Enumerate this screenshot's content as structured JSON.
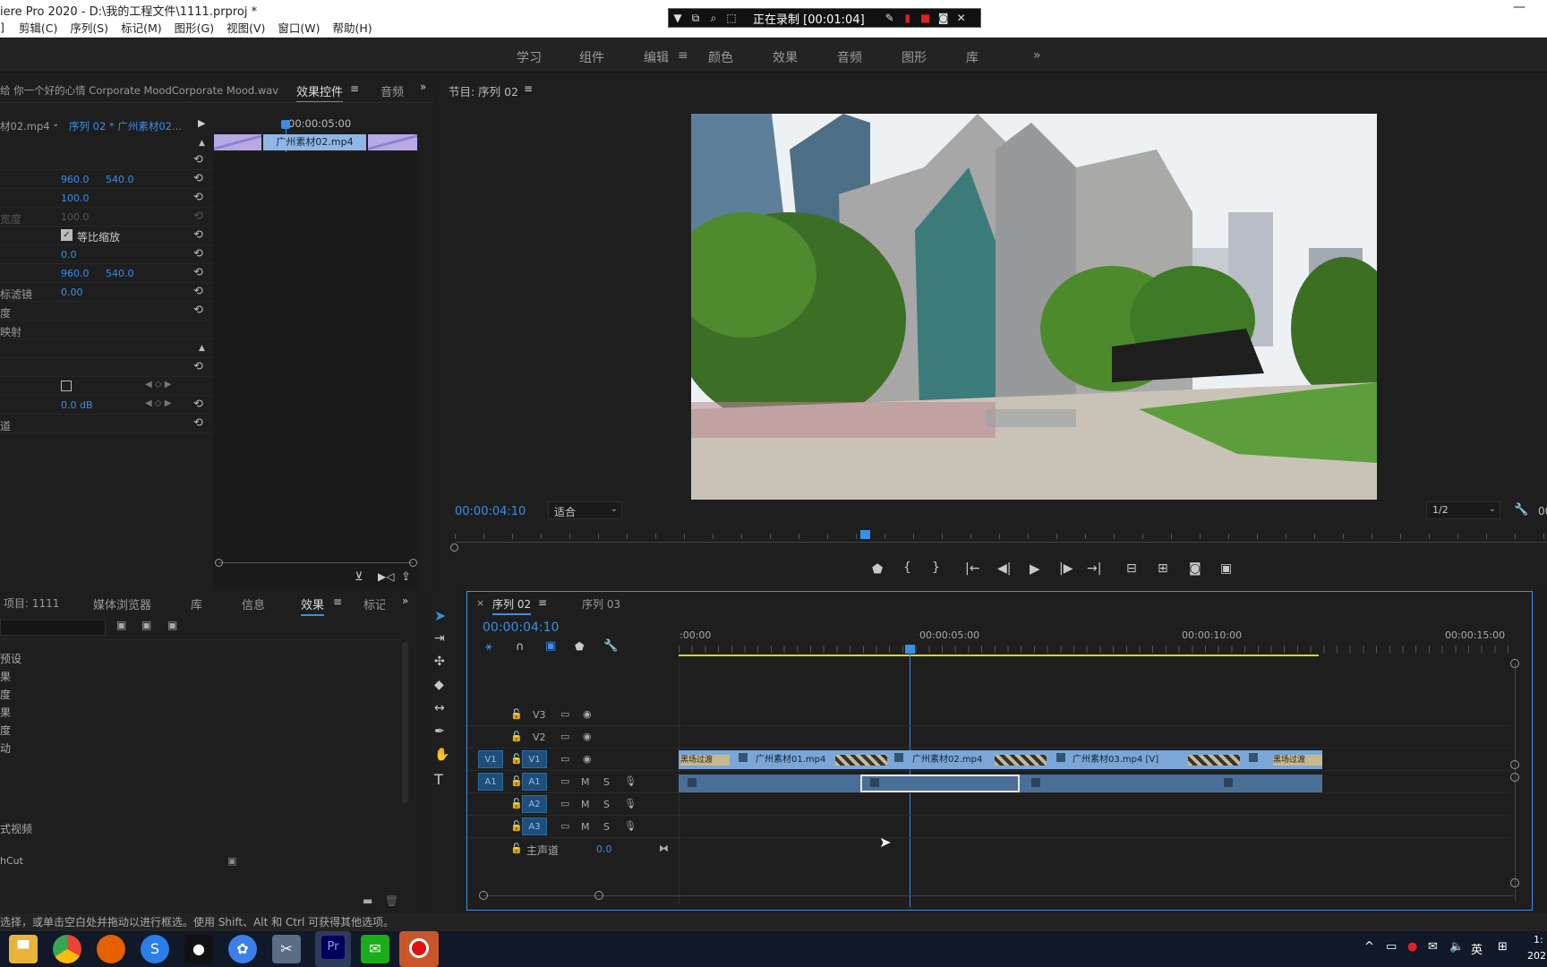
{
  "window": {
    "title": "iere Pro 2020 - D:\\我的工程文件\\1111.prproj *"
  },
  "menu": [
    "剪辑(C)",
    "序列(S)",
    "标记(M)",
    "图形(G)",
    "视图(V)",
    "窗口(W)",
    "帮助(H)"
  ],
  "recorder": {
    "status": "正在录制 [00:01:04]"
  },
  "workspaces": [
    {
      "label": "学习",
      "active": false
    },
    {
      "label": "组件",
      "active": false
    },
    {
      "label": "编辑",
      "active": true
    },
    {
      "label": "颜色",
      "active": false
    },
    {
      "label": "效果",
      "active": false
    },
    {
      "label": "音频",
      "active": false
    },
    {
      "label": "图形",
      "active": false
    },
    {
      "label": "库",
      "active": false
    }
  ],
  "source_panel": {
    "audio_title": "给 你一个好的心情 Corporate MoodCorporate Mood.wav",
    "tab_effect_controls": "效果控件",
    "tab_audio": "音频",
    "source_clip": "材02.mp4",
    "sequence_clip": "序列 02 * 广州素材02...",
    "timecode": "00:00:05:00",
    "clip_name": "广州素材02.mp4",
    "rows": [
      {
        "label": "",
        "v1": "",
        "v2": ""
      },
      {
        "label": "",
        "v1": "960.0",
        "v2": "540.0"
      },
      {
        "label": "",
        "v1": "100.0",
        "v2": ""
      },
      {
        "label": "宽度",
        "v1": "100.0",
        "v2": "",
        "dim": true
      },
      {
        "label": "",
        "v1": "等比缩放",
        "v2": "",
        "check": true
      },
      {
        "label": "",
        "v1": "0.0",
        "v2": ""
      },
      {
        "label": "",
        "v1": "960.0",
        "v2": "540.0"
      },
      {
        "label": "标滤镜",
        "v1": "0.00",
        "v2": ""
      },
      {
        "label": "度",
        "v1": "",
        "v2": ""
      },
      {
        "label": "映射",
        "v1": "",
        "v2": ""
      },
      {
        "label": "",
        "v1": "",
        "v2": ""
      },
      {
        "label": "",
        "v1": "",
        "v2": ""
      },
      {
        "label": "",
        "v1": "",
        "v2": ""
      },
      {
        "label": "",
        "v1": "0.0 dB",
        "v2": ""
      },
      {
        "label": "道",
        "v1": "",
        "v2": ""
      }
    ]
  },
  "program": {
    "title": "节目: 序列 02",
    "timecode": "00:00:04:10",
    "fit": "适合",
    "resolution": "1/2",
    "right_timecode": "00"
  },
  "project_panel": {
    "tabs": [
      "项目: 1111",
      "媒体浏览器",
      "库",
      "信息",
      "效果",
      "标记"
    ],
    "active_tab": "效果",
    "items": [
      "预设",
      "果",
      "度",
      "果",
      "度",
      "动",
      "",
      "",
      "",
      "",
      "式视频",
      "",
      "hCut"
    ]
  },
  "timeline": {
    "tabs": [
      {
        "label": "序列 02",
        "active": true
      },
      {
        "label": "序列 03",
        "active": false
      }
    ],
    "timecode": "00:00:04:10",
    "ruler": [
      ":00:00",
      "00:00:05:00",
      "00:00:10:00",
      "00:00:15:00"
    ],
    "tracks": [
      {
        "name": "V3",
        "target": "",
        "kind": "video"
      },
      {
        "name": "V2",
        "target": "",
        "kind": "video"
      },
      {
        "name": "V1",
        "target": "V1",
        "kind": "video"
      },
      {
        "name": "A1",
        "target": "A1",
        "kind": "audio"
      },
      {
        "name": "A2",
        "target": "",
        "kind": "audio"
      },
      {
        "name": "A3",
        "target": "",
        "kind": "audio"
      }
    ],
    "master_label": "主声道",
    "master_value": "0.0",
    "video_clips": [
      "黑场过渡",
      "广州素材01.mp4 [",
      "广州素材02.mp4 [",
      "广州素材03.mp4 [V]",
      "黑场过渡"
    ],
    "letters": {
      "m": "M",
      "s": "S"
    }
  },
  "status": "选择，或单击空白处并拖动以进行框选。使用 Shift、Alt 和 Ctrl 可获得其他选项。",
  "taskbar": {
    "ime": "英",
    "clock_top": "1:",
    "clock_bottom": "202",
    "pr": "Pr"
  },
  "colors": {
    "accent": "#3a8ee6",
    "clip_video": "#7aa7d6",
    "clip_audio": "#4a6f97",
    "work_area": "#d8d23a"
  }
}
